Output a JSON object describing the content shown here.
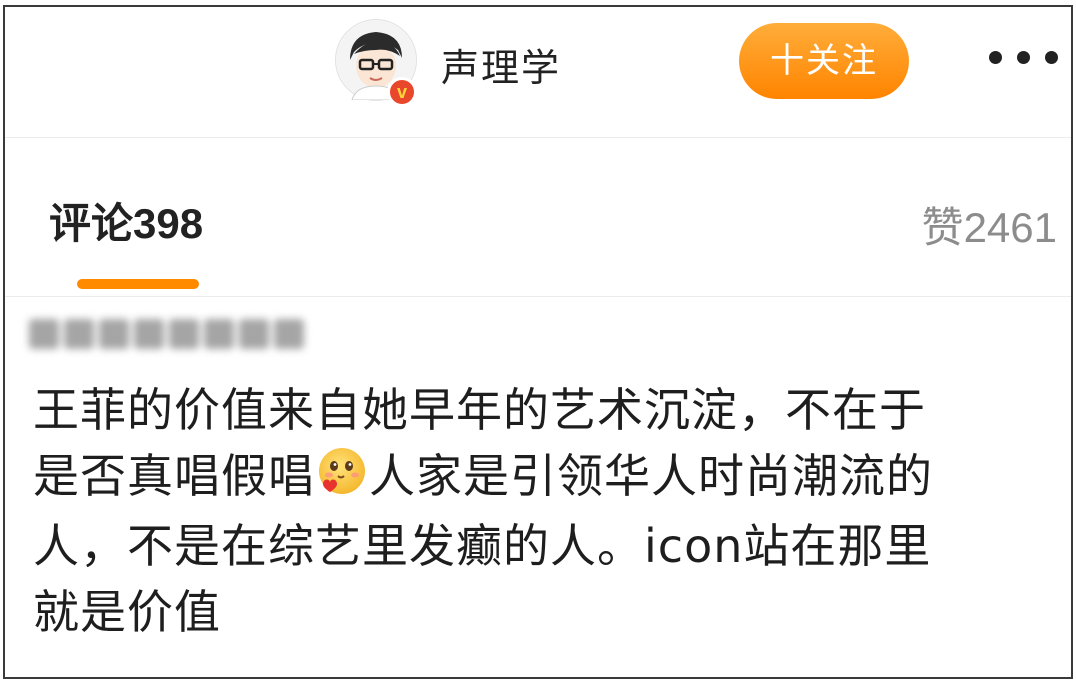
{
  "header": {
    "username": "声理学",
    "verified_badge": "v",
    "follow_label": "十关注",
    "more_icon": "more-dots-icon"
  },
  "tabs": {
    "comments_label": "评论",
    "comments_count": "398",
    "likes_label": "赞",
    "likes_count": "2461"
  },
  "comment": {
    "author": "",
    "lines": [
      "王菲的价值来自她早年的艺术沉淀，不在于",
      "是否真唱假唱",
      "人家是引领华人时尚潮流的",
      "人，不是在综艺里发癫的人。icon站在那里",
      "就是价值"
    ],
    "emoji_icon": "blushing-heart-emoji-icon"
  },
  "colors": {
    "accent_orange": "#ff8a00",
    "follow_gradient_top": "#ffad3a",
    "follow_gradient_bottom": "#ff8400",
    "verified_red": "#e8472c"
  }
}
